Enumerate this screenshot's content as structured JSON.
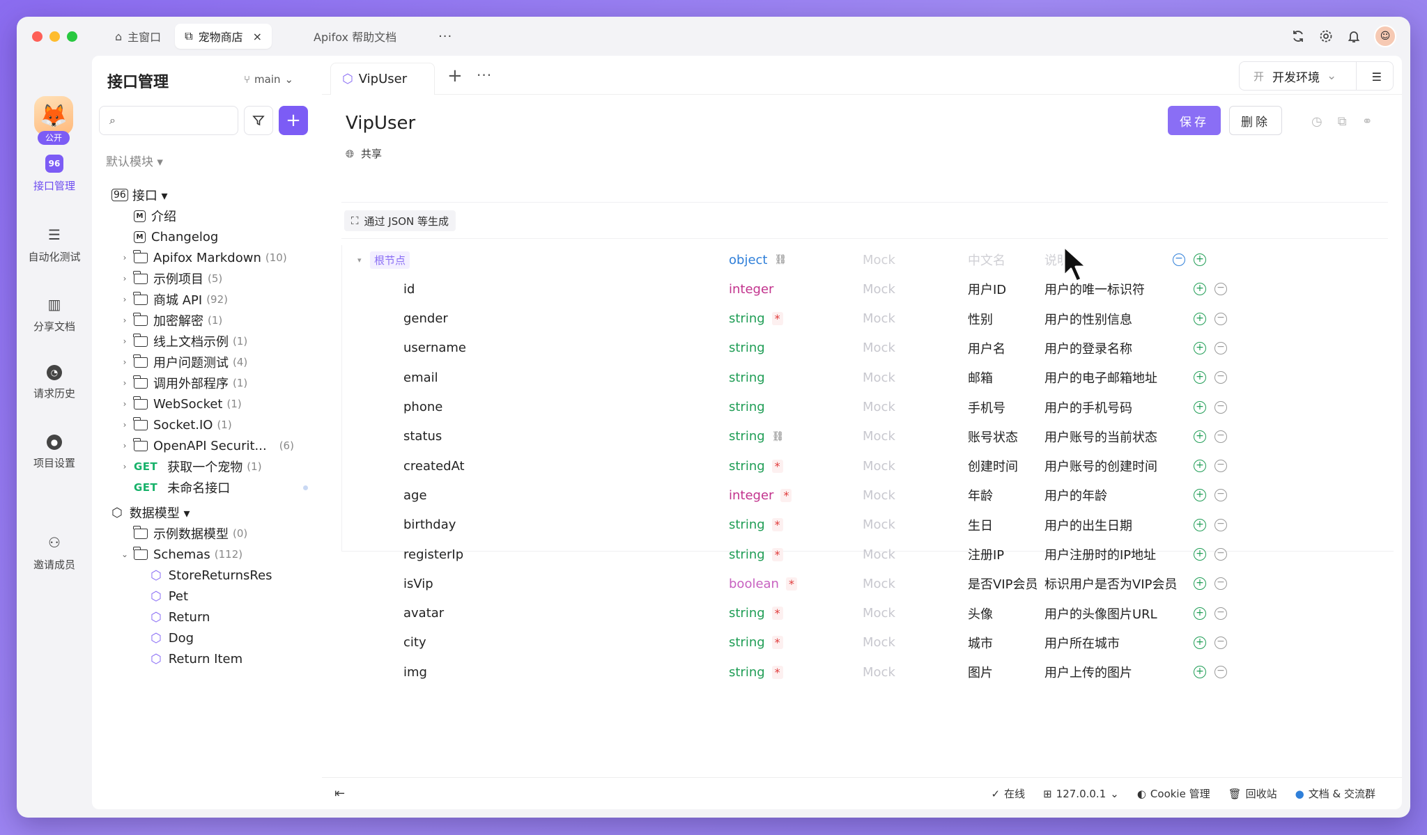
{
  "titlebar": {
    "tabs": [
      {
        "label": "主窗口"
      },
      {
        "label": "宠物商店",
        "close": "×"
      },
      {
        "label": "Apifox 帮助文档"
      }
    ],
    "more": "···"
  },
  "rail": {
    "badge": "公开",
    "items": [
      {
        "label": "接口管理",
        "icon": "api-icon"
      },
      {
        "label": "自动化测试",
        "icon": "automation-icon"
      },
      {
        "label": "分享文档",
        "icon": "book-icon"
      },
      {
        "label": "请求历史",
        "icon": "clock-icon"
      },
      {
        "label": "项目设置",
        "icon": "settings-icon"
      },
      {
        "label": "邀请成员",
        "icon": "user-add-icon"
      }
    ]
  },
  "sidebar": {
    "title": "接口管理",
    "branch": "main",
    "search_placeholder": "",
    "module": "默认模块 ▾",
    "tree": [
      {
        "label": "接口 ▾",
        "count": ""
      },
      {
        "label": "介绍",
        "count": ""
      },
      {
        "label": "Changelog",
        "count": ""
      },
      {
        "label": "Apifox Markdown",
        "count": "(10)"
      },
      {
        "label": "示例项目",
        "count": "(5)"
      },
      {
        "label": "商城 API",
        "count": "(92)"
      },
      {
        "label": "加密解密",
        "count": "(1)"
      },
      {
        "label": "线上文档示例",
        "count": "(1)"
      },
      {
        "label": "用户问题测试",
        "count": "(4)"
      },
      {
        "label": "调用外部程序",
        "count": "(1)"
      },
      {
        "label": "WebSocket",
        "count": "(1)"
      },
      {
        "label": "Socket.IO",
        "count": "(1)"
      },
      {
        "label": "OpenAPI Securit...",
        "count": "(6)"
      },
      {
        "label": "获取一个宠物",
        "count": "(1)",
        "method": "GET"
      },
      {
        "label": "未命名接口",
        "count": "",
        "method": "GET"
      },
      {
        "label": "数据模型 ▾",
        "count": ""
      },
      {
        "label": "示例数据模型",
        "count": "(0)"
      },
      {
        "label": "Schemas",
        "count": "(112)"
      },
      {
        "label": "StoreReturnsRes",
        "count": ""
      },
      {
        "label": "Pet",
        "count": ""
      },
      {
        "label": "Return",
        "count": ""
      },
      {
        "label": "Dog",
        "count": ""
      },
      {
        "label": "Return Item",
        "count": ""
      }
    ]
  },
  "main": {
    "tab": "VipUser",
    "env": {
      "tag": "开",
      "label": "开发环境"
    },
    "title": "VipUser",
    "share": "共享",
    "save": "保存",
    "delete": "删除",
    "gen_json": "通过 JSON 等生成",
    "header": {
      "name": "根节点",
      "type": "object",
      "mock": "Mock",
      "cn": "中文名",
      "desc": "说明"
    },
    "fields": [
      {
        "name": "id",
        "type": "integer",
        "req": false,
        "cn": "用户ID",
        "desc": "用户的唯一标识符"
      },
      {
        "name": "gender",
        "type": "string",
        "req": true,
        "cn": "性别",
        "desc": "用户的性别信息"
      },
      {
        "name": "username",
        "type": "string",
        "req": false,
        "cn": "用户名",
        "desc": "用户的登录名称"
      },
      {
        "name": "email",
        "type": "string",
        "req": false,
        "cn": "邮箱",
        "desc": "用户的电子邮箱地址"
      },
      {
        "name": "phone",
        "type": "string",
        "req": false,
        "cn": "手机号",
        "desc": "用户的手机号码"
      },
      {
        "name": "status",
        "type": "string",
        "req": false,
        "cn": "账号状态",
        "desc": "用户账号的当前状态"
      },
      {
        "name": "createdAt",
        "type": "string",
        "req": true,
        "cn": "创建时间",
        "desc": "用户账号的创建时间"
      },
      {
        "name": "age",
        "type": "integer",
        "req": true,
        "cn": "年龄",
        "desc": "用户的年龄"
      },
      {
        "name": "birthday",
        "type": "string",
        "req": true,
        "cn": "生日",
        "desc": "用户的出生日期"
      },
      {
        "name": "registerIp",
        "type": "string",
        "req": true,
        "cn": "注册IP",
        "desc": "用户注册时的IP地址"
      },
      {
        "name": "isVip",
        "type": "boolean",
        "req": true,
        "cn": "是否VIP会员",
        "desc": "标识用户是否为VIP会员"
      },
      {
        "name": "avatar",
        "type": "string",
        "req": true,
        "cn": "头像",
        "desc": "用户的头像图片URL"
      },
      {
        "name": "city",
        "type": "string",
        "req": true,
        "cn": "城市",
        "desc": "用户所在城市"
      },
      {
        "name": "img",
        "type": "string",
        "req": true,
        "cn": "图片",
        "desc": "用户上传的图片"
      }
    ],
    "mock": "Mock",
    "required_mark": "*"
  },
  "statusbar": {
    "online": "在线",
    "host": "127.0.0.1",
    "cookie": "Cookie 管理",
    "trash": "回收站",
    "docs": "文档 & 交流群"
  },
  "colors": {
    "accent": "#8a6ef5",
    "string": "#1f9d55",
    "integer": "#c2338d",
    "boolean": "#c761c0",
    "object": "#2f7fd9"
  }
}
